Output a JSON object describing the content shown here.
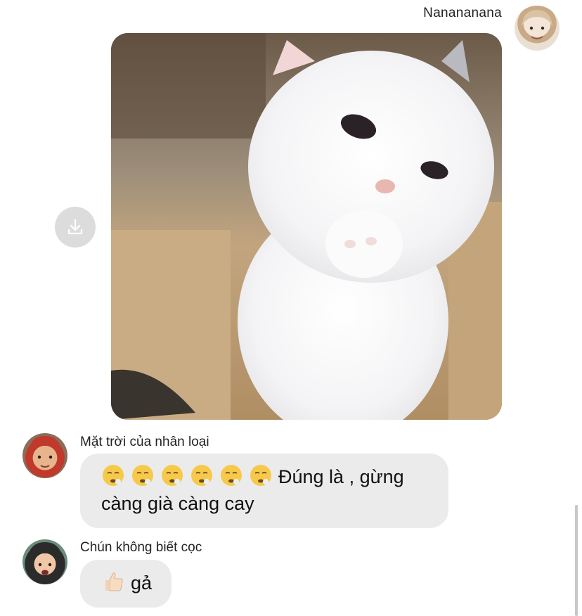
{
  "conversation": {
    "outgoing": {
      "sender_name": "Nanananana",
      "avatar_icon": "user-avatar",
      "attachment": {
        "type": "image",
        "description_icon": "kitten-photo",
        "download_icon": "download-icon"
      }
    },
    "incoming": [
      {
        "sender_name": "Mặt trời của nhân loại",
        "avatar_icon": "user-avatar",
        "emoji_count": 6,
        "emoji_icon": "face-exhaling-emoji",
        "text": "Đúng là , gừng càng già càng cay"
      },
      {
        "sender_name": "Chún không biết cọc",
        "avatar_icon": "user-avatar",
        "emoji_icon": "thumbs-up-emoji",
        "text": "gả"
      }
    ]
  },
  "colors": {
    "bubble": "#ebebeb",
    "download_bg": "#dcdcdc",
    "text": "#111111"
  }
}
